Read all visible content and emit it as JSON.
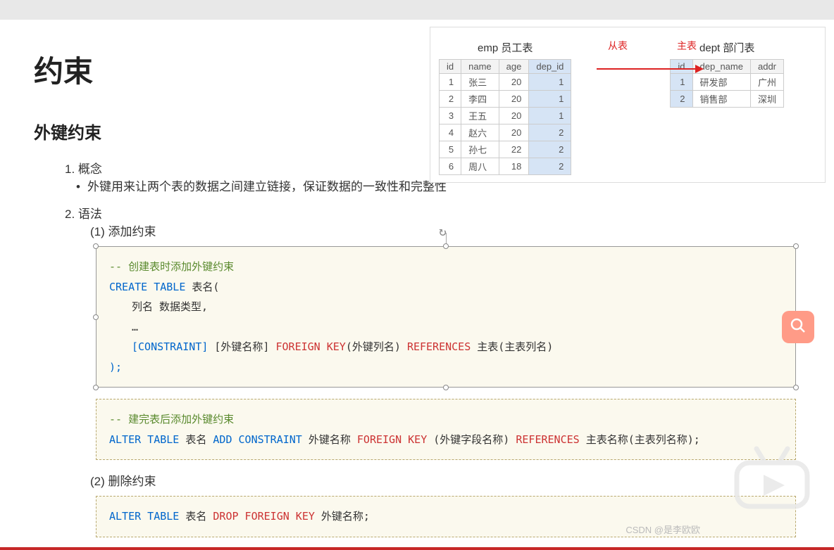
{
  "title": "约束",
  "subtitle": "外键约束",
  "outline": {
    "item1": "1. 概念",
    "item1_bullet": "外键用来让两个表的数据之间建立链接，保证数据的一致性和完整性",
    "item2": "2. 语法",
    "sub1": "(1)  添加约束",
    "sub2": "(2)  删除约束"
  },
  "code1": {
    "comment": "-- 创建表时添加外键约束",
    "l1a": "CREATE TABLE",
    "l1b": " 表名(",
    "l2": "列名  数据类型,",
    "l3": "…",
    "l4_constraint": "[CONSTRAINT]",
    "l4_fkname": " [外键名称] ",
    "l4_fk": "FOREIGN KEY",
    "l4_col": "(外键列名) ",
    "l4_ref": "REFERENCES",
    "l4_end": " 主表(主表列名)",
    "l5": ");"
  },
  "code2": {
    "comment": "-- 建完表后添加外键约束",
    "l_alter": "ALTER TABLE",
    "l_tbl": " 表名 ",
    "l_add": "ADD CONSTRAINT",
    "l_fkname": " 外键名称 ",
    "l_fk": "FOREIGN KEY",
    "l_col": " (外键字段名称) ",
    "l_ref": "REFERENCES",
    "l_end": " 主表名称(主表列名称);"
  },
  "code3": {
    "l_alter": "ALTER TABLE",
    "l_tbl": " 表名 ",
    "l_drop": "DROP FOREIGN KEY",
    "l_end": " 外键名称;"
  },
  "diagram": {
    "emp_title": "emp 员工表",
    "dept_title": "dept 部门表",
    "label_cong": "从表",
    "label_zhu": "主表",
    "emp_headers": [
      "id",
      "name",
      "age",
      "dep_id"
    ],
    "emp_rows": [
      [
        "1",
        "张三",
        "20",
        "1"
      ],
      [
        "2",
        "李四",
        "20",
        "1"
      ],
      [
        "3",
        "王五",
        "20",
        "1"
      ],
      [
        "4",
        "赵六",
        "20",
        "2"
      ],
      [
        "5",
        "孙七",
        "22",
        "2"
      ],
      [
        "6",
        "周八",
        "18",
        "2"
      ]
    ],
    "dept_headers": [
      "id",
      "dep_name",
      "addr"
    ],
    "dept_rows": [
      [
        "1",
        "研发部",
        "广州"
      ],
      [
        "2",
        "销售部",
        "深圳"
      ]
    ]
  },
  "watermark": "CSDN @是李欧欧"
}
